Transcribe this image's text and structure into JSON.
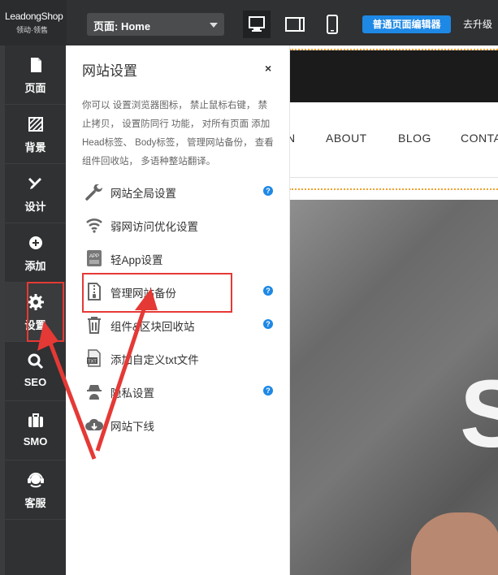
{
  "header": {
    "logo_line1": "LeadongShop",
    "logo_line2": "领动·领售",
    "page_select": "页面: Home",
    "editor_button": "普通页面编辑器",
    "upgrade": "去升级"
  },
  "sidebar": {
    "items": [
      {
        "label": "页面",
        "icon": "page-icon"
      },
      {
        "label": "背景",
        "icon": "background-icon"
      },
      {
        "label": "设计",
        "icon": "design-icon"
      },
      {
        "label": "添加",
        "icon": "add-icon"
      },
      {
        "label": "设置",
        "icon": "gear-icon"
      },
      {
        "label": "SEO",
        "icon": "search-icon"
      },
      {
        "label": "SMO",
        "icon": "briefcase-icon"
      },
      {
        "label": "客服",
        "icon": "headset-icon"
      }
    ]
  },
  "panel": {
    "title": "网站设置",
    "close": "×",
    "description": "你可以 设置浏览器图标， 禁止鼠标右键， 禁止拷贝， 设置防同行 功能， 对所有页面 添加 Head标签、 Body标签， 管理网站备份， 查看 组件回收站， 多语种整站翻译。",
    "items": [
      {
        "label": "网站全局设置",
        "icon": "wrench-icon",
        "help": true
      },
      {
        "label": "弱网访问优化设置",
        "icon": "wifi-icon",
        "help": false
      },
      {
        "label": "轻App设置",
        "icon": "app-icon",
        "help": false
      },
      {
        "label": "管理网站备份",
        "icon": "zip-icon",
        "help": true
      },
      {
        "label": "组件&区块回收站",
        "icon": "trash-icon",
        "help": true
      },
      {
        "label": "添加自定义txt文件",
        "icon": "txt-file-icon",
        "help": false
      },
      {
        "label": "隐私设置",
        "icon": "spy-icon",
        "help": true
      },
      {
        "label": "网站下线",
        "icon": "cloud-download-icon",
        "help": false
      }
    ],
    "help_glyph": "?"
  },
  "preview": {
    "nav": [
      "N",
      "ABOUT",
      "BLOG",
      "CONTA"
    ],
    "hero_letter": "S"
  },
  "colors": {
    "sidebar_bg": "#2f3133",
    "accent_blue": "#1e88e5",
    "annotation_red": "#e53935"
  }
}
